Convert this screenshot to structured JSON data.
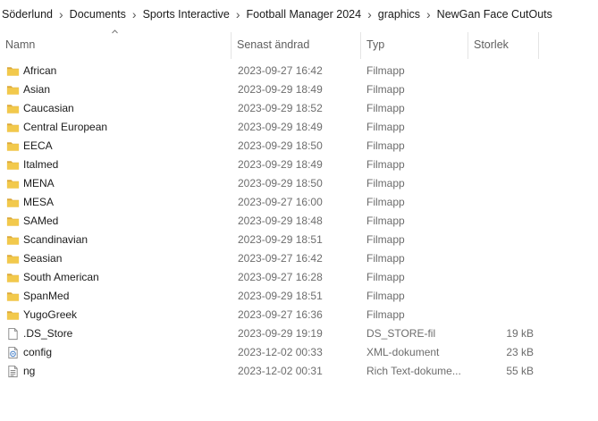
{
  "breadcrumb": [
    "Söderlund",
    "Documents",
    "Sports Interactive",
    "Football Manager 2024",
    "graphics",
    "NewGan Face CutOuts"
  ],
  "columns": {
    "name": "Namn",
    "modified": "Senast ändrad",
    "type": "Typ",
    "size": "Storlek"
  },
  "files": [
    {
      "name": "African",
      "modified": "2023-09-27 16:42",
      "type": "Filmapp",
      "size": "",
      "icon": "folder-icon"
    },
    {
      "name": "Asian",
      "modified": "2023-09-29 18:49",
      "type": "Filmapp",
      "size": "",
      "icon": "folder-icon"
    },
    {
      "name": "Caucasian",
      "modified": "2023-09-29 18:52",
      "type": "Filmapp",
      "size": "",
      "icon": "folder-icon"
    },
    {
      "name": "Central European",
      "modified": "2023-09-29 18:49",
      "type": "Filmapp",
      "size": "",
      "icon": "folder-icon"
    },
    {
      "name": "EECA",
      "modified": "2023-09-29 18:50",
      "type": "Filmapp",
      "size": "",
      "icon": "folder-icon"
    },
    {
      "name": "Italmed",
      "modified": "2023-09-29 18:49",
      "type": "Filmapp",
      "size": "",
      "icon": "folder-icon"
    },
    {
      "name": "MENA",
      "modified": "2023-09-29 18:50",
      "type": "Filmapp",
      "size": "",
      "icon": "folder-icon"
    },
    {
      "name": "MESA",
      "modified": "2023-09-27 16:00",
      "type": "Filmapp",
      "size": "",
      "icon": "folder-icon"
    },
    {
      "name": "SAMed",
      "modified": "2023-09-29 18:48",
      "type": "Filmapp",
      "size": "",
      "icon": "folder-icon"
    },
    {
      "name": "Scandinavian",
      "modified": "2023-09-29 18:51",
      "type": "Filmapp",
      "size": "",
      "icon": "folder-icon"
    },
    {
      "name": "Seasian",
      "modified": "2023-09-27 16:42",
      "type": "Filmapp",
      "size": "",
      "icon": "folder-icon"
    },
    {
      "name": "South American",
      "modified": "2023-09-27 16:28",
      "type": "Filmapp",
      "size": "",
      "icon": "folder-icon"
    },
    {
      "name": "SpanMed",
      "modified": "2023-09-29 18:51",
      "type": "Filmapp",
      "size": "",
      "icon": "folder-icon"
    },
    {
      "name": "YugoGreek",
      "modified": "2023-09-27 16:36",
      "type": "Filmapp",
      "size": "",
      "icon": "folder-icon"
    },
    {
      "name": ".DS_Store",
      "modified": "2023-09-29 19:19",
      "type": "DS_STORE-fil",
      "size": "19 kB",
      "icon": "file-icon"
    },
    {
      "name": "config",
      "modified": "2023-12-02 00:33",
      "type": "XML-dokument",
      "size": "23 kB",
      "icon": "xml-file-icon"
    },
    {
      "name": "ng",
      "modified": "2023-12-02 00:31",
      "type": "Rich Text-dokume...",
      "size": "55 kB",
      "icon": "rtf-file-icon"
    }
  ],
  "colors": {
    "folder": "#f2c94c",
    "folder_dark": "#dca93a",
    "header_text": "#5f5f5f",
    "meta_text": "#6d6d6d"
  }
}
